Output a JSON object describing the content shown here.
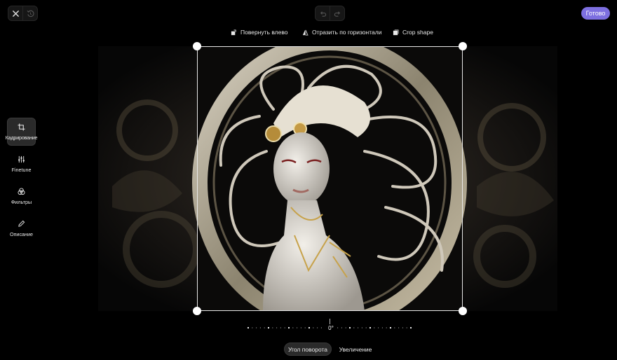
{
  "header": {
    "close_icon": "close-icon",
    "revert_icon": "revert-icon",
    "undo_icon": "undo-icon",
    "redo_icon": "redo-icon",
    "done_label": "Готово",
    "done_color": "#7d6fe0"
  },
  "crop_toolbar": {
    "rotate_label": "Повернуть влево",
    "flip_label": "Отразить по горизонтали",
    "shape_label": "Crop shape"
  },
  "sidebar": {
    "items": [
      {
        "label": "Кадрирование",
        "icon": "crop-icon",
        "active": true
      },
      {
        "label": "Finetune",
        "icon": "sliders-icon",
        "active": false
      },
      {
        "label": "Фильтры",
        "icon": "filters-icon",
        "active": false
      },
      {
        "label": "Описание",
        "icon": "pencil-icon",
        "active": false
      }
    ]
  },
  "canvas": {
    "image_alt": "Ornate porcelain figure of a woman with flowing white and gold hair in a circular frame",
    "rotation_value": "0°"
  },
  "bottom_tabs": {
    "angle_label": "Угол поворота",
    "zoom_label": "Увеличение",
    "active": "angle"
  }
}
